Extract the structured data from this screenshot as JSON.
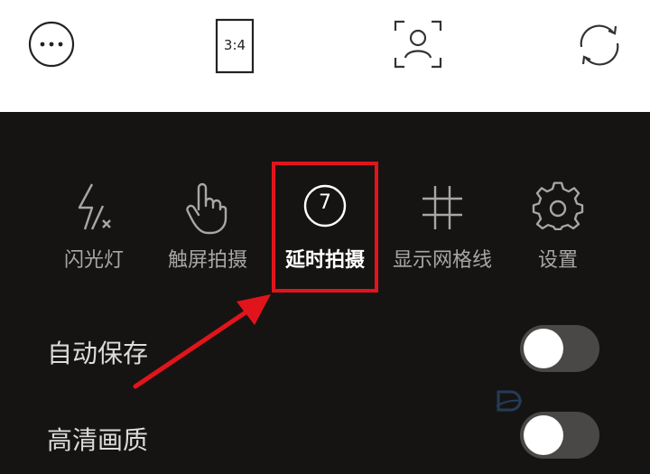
{
  "topbar": {
    "more_icon": "more-dots-icon",
    "aspect_ratio_label": "3:4",
    "face_icon": "face-scan-icon",
    "switch_icon": "camera-switch-icon"
  },
  "tools": [
    {
      "label": "闪光灯",
      "icon": "flash-off-icon"
    },
    {
      "label": "触屏拍摄",
      "icon": "touch-capture-icon"
    },
    {
      "label": "延时拍摄",
      "icon": "timer-icon",
      "badge": "7",
      "active": true
    },
    {
      "label": "显示网格线",
      "icon": "grid-icon"
    },
    {
      "label": "设置",
      "icon": "gear-icon"
    }
  ],
  "settings": [
    {
      "label": "自动保存",
      "state": "off"
    },
    {
      "label": "高清画质",
      "state": "off"
    }
  ],
  "colors": {
    "highlight": "#e2141b",
    "panel_bg": "#161413",
    "topbar_bg": "#ffffff"
  }
}
